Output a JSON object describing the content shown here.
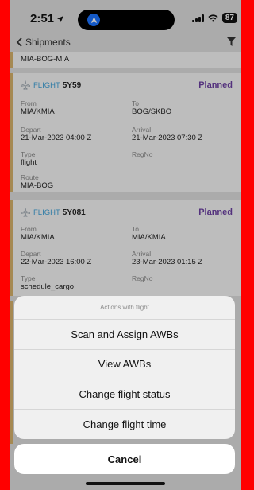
{
  "status_bar": {
    "time": "2:51",
    "battery": "87"
  },
  "nav": {
    "back_label": "Shipments"
  },
  "partial_card": {
    "route": "MIA-BOG-MIA"
  },
  "flights": [
    {
      "flight_label": "FLIGHT",
      "flight_number": "5Y59",
      "status": "Planned",
      "from_label": "From",
      "from": "MIA/KMIA",
      "to_label": "To",
      "to": "BOG/SKBO",
      "depart_label": "Depart",
      "depart": "21-Mar-2023 04:00 Z",
      "arrival_label": "Arrival",
      "arrival": "21-Mar-2023 07:30 Z",
      "type_label": "Type",
      "type": "flight",
      "regno_label": "RegNo",
      "route_label": "Route",
      "route": "MIA-BOG"
    },
    {
      "flight_label": "FLIGHT",
      "flight_number": "5Y081",
      "status": "Planned",
      "from_label": "From",
      "from": "MIA/KMIA",
      "to_label": "To",
      "to": "MIA/KMIA",
      "depart_label": "Depart",
      "depart": "22-Mar-2023 16:00 Z",
      "arrival_label": "Arrival",
      "arrival": "23-Mar-2023 01:15 Z",
      "type_label": "Type",
      "type": "schedule_cargo",
      "regno_label": "RegNo"
    }
  ],
  "action_sheet": {
    "title": "Actions with flight",
    "items": [
      "Scan and Assign AWBs",
      "View AWBs",
      "Change flight status",
      "Change flight time"
    ],
    "cancel": "Cancel"
  },
  "colors": {
    "accent_stripe": "#d4b06a",
    "flight_label": "#3fa0d6",
    "status": "#6b3fa0",
    "frame": "#ff0000"
  }
}
